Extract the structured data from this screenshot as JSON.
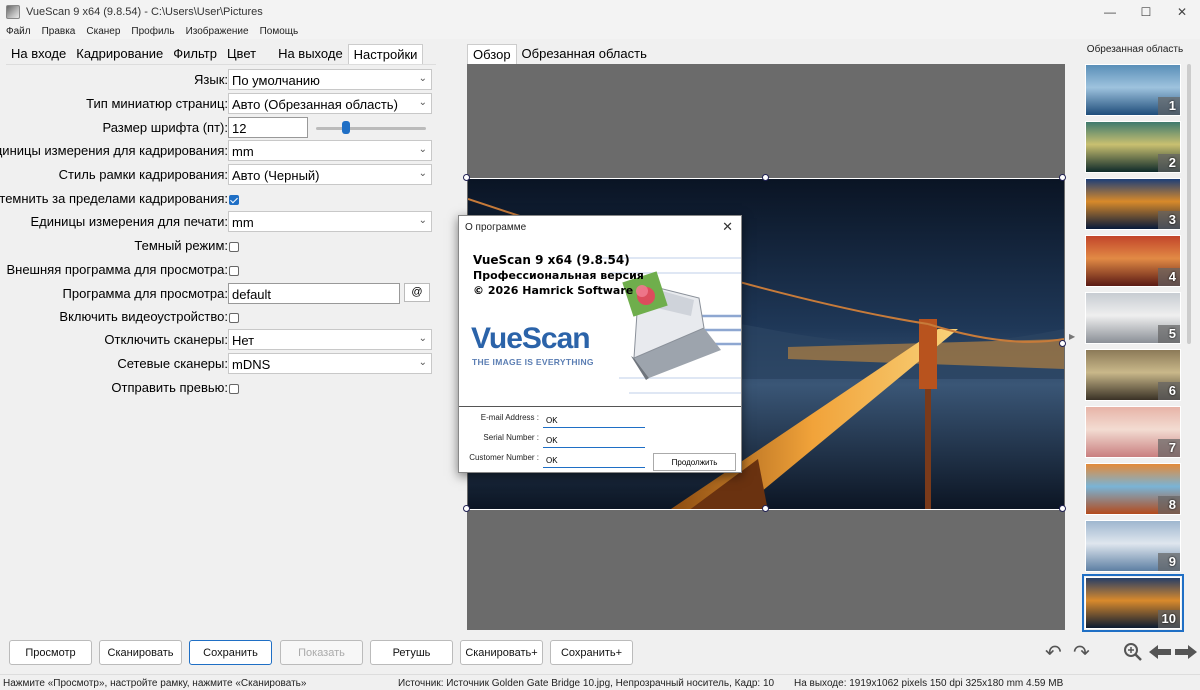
{
  "window": {
    "title": "VueScan 9 x64 (9.8.54) - C:\\Users\\User\\Pictures",
    "minimize_glyph": "—",
    "maximize_glyph": "☐",
    "close_glyph": "✕"
  },
  "menu": [
    "Файл",
    "Правка",
    "Сканер",
    "Профиль",
    "Изображение",
    "Помощь"
  ],
  "left_tabs": [
    "На входе",
    "Кадрирование",
    "Фильтр",
    "Цвет",
    "На выходе",
    "Настройки"
  ],
  "settings": {
    "language": {
      "label": "Язык:",
      "value": "По умолчанию"
    },
    "thumb_type": {
      "label": "Тип миниатюр страниц:",
      "value": "Авто (Обрезанная область)"
    },
    "font_size": {
      "label": "Размер шрифта (пт):",
      "value": "12"
    },
    "crop_units": {
      "label": "Единицы измерения для кадрирования:",
      "value": "mm"
    },
    "crop_style": {
      "label": "Стиль рамки кадрирования:",
      "value": "Авто (Черный)"
    },
    "darken": {
      "label": "Затемнить за пределами кадрирования:",
      "checked": true
    },
    "print_units": {
      "label": "Единицы измерения для печати:",
      "value": "mm"
    },
    "dark_mode": {
      "label": "Темный режим:",
      "checked": false
    },
    "external_viewer": {
      "label": "Внешняя программа для просмотра:",
      "checked": false
    },
    "viewer_program": {
      "label": "Программа для просмотра:",
      "value": "default",
      "button": "@"
    },
    "video_device": {
      "label": "Включить видеоустройство:",
      "checked": false
    },
    "disable_scanners": {
      "label": "Отключить сканеры:",
      "value": "Нет"
    },
    "network_scanners": {
      "label": "Сетевые сканеры:",
      "value": "mDNS"
    },
    "send_preview": {
      "label": "Отправить превью:",
      "checked": false
    }
  },
  "center_tabs": [
    "Обзор",
    "Обрезанная область"
  ],
  "thumbs_header": "Обрезанная область",
  "thumbnails": [
    {
      "num": "1",
      "colors": [
        "#1f4d7a",
        "#5a8fb8",
        "#9ec3de"
      ]
    },
    {
      "num": "2",
      "colors": [
        "#0e2a2a",
        "#3f7a6e",
        "#c9c070"
      ]
    },
    {
      "num": "3",
      "colors": [
        "#071a3b",
        "#1e3f77",
        "#d88a2a"
      ]
    },
    {
      "num": "4",
      "colors": [
        "#5a1a14",
        "#c2452a",
        "#e28a45"
      ]
    },
    {
      "num": "5",
      "colors": [
        "#8a8f96",
        "#c7ccd2",
        "#efefef"
      ]
    },
    {
      "num": "6",
      "colors": [
        "#3a3226",
        "#8c7a58",
        "#c9b88a"
      ]
    },
    {
      "num": "7",
      "colors": [
        "#c97f7f",
        "#e7b4a8",
        "#f3dcd2"
      ]
    },
    {
      "num": "8",
      "colors": [
        "#b34a1c",
        "#e38a3a",
        "#7ab4d6"
      ]
    },
    {
      "num": "9",
      "colors": [
        "#5d7fa3",
        "#9fb7cf",
        "#dfe6ee"
      ]
    },
    {
      "num": "10",
      "colors": [
        "#0c1c33",
        "#263e66",
        "#d98a2c"
      ],
      "selected": true
    }
  ],
  "buttons": [
    {
      "label": "Просмотр",
      "state": "normal"
    },
    {
      "label": "Сканировать",
      "state": "normal"
    },
    {
      "label": "Сохранить",
      "state": "primary"
    },
    {
      "label": "Показать",
      "state": "disabled"
    },
    {
      "label": "Ретушь",
      "state": "normal"
    },
    {
      "label": "Сканировать+",
      "state": "normal"
    },
    {
      "label": "Сохранить+",
      "state": "normal"
    }
  ],
  "tool_icons": [
    "rotate-left-icon",
    "rotate-right-icon",
    "zoom-in-icon",
    "arrow-left-icon",
    "arrow-right-icon"
  ],
  "status": {
    "hint": "Нажмите «Просмотр», настройте рамку, нажмите «Сканировать»",
    "source": "Источник: Источник Golden Gate Bridge 10.jpg, Непрозрачный носитель, Кадр: 10",
    "output": "На выходе: 1919x1062 pixels 150 dpi 325x180 mm 4.59 MB"
  },
  "about": {
    "title": "О программе",
    "line1": "VueScan 9 x64 (9.8.54)",
    "line2": "Профессиональная версия",
    "line3": "© 2026 Hamrick Software",
    "logo": "VueScan",
    "tagline": "THE IMAGE IS EVERYTHING",
    "email_label": "E-mail Address :",
    "email_value": "OK",
    "serial_label": "Serial Number :",
    "serial_value": "OK",
    "customer_label": "Customer Number :",
    "customer_value": "OK",
    "continue_label": "Продолжить"
  }
}
